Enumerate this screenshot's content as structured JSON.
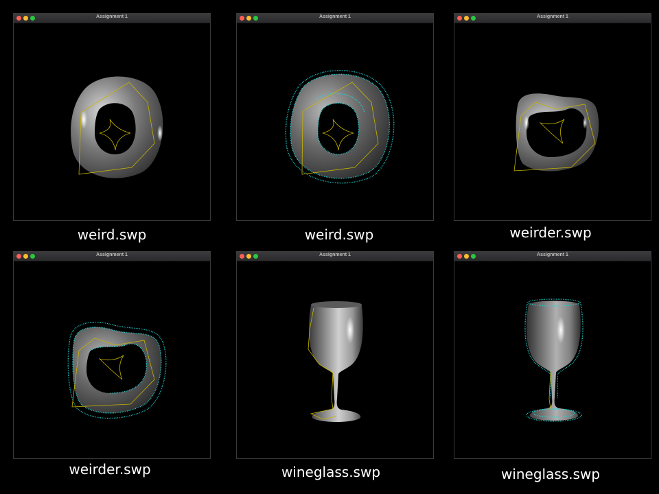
{
  "windows": [
    {
      "title": "Assignment 1",
      "caption": "weird.swp"
    },
    {
      "title": "Assignment 1",
      "caption": "weird.swp"
    },
    {
      "title": "Assignment 1",
      "caption": "weirder.swp"
    },
    {
      "title": "Assignment 1",
      "caption": "weirder.swp"
    },
    {
      "title": "Assignment 1",
      "caption": "wineglass.swp"
    },
    {
      "title": "Assignment 1",
      "caption": "wineglass.swp"
    }
  ],
  "colors": {
    "background": "#000000",
    "surface": "#8a8a8a",
    "control_curve": "#c8b400",
    "normals": "#22d3d3",
    "close": "#ff5f57",
    "minimize": "#febc2e",
    "zoom": "#28c840"
  }
}
